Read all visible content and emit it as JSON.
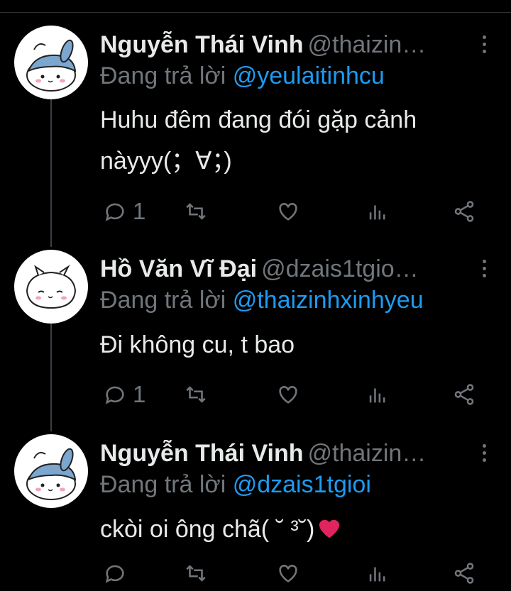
{
  "tweets": [
    {
      "name": "Nguyễn Thái Vinh",
      "handle": "@thaizin…",
      "reply_prefix": "Đang trả lời",
      "reply_to": "@yeulaitinhcu",
      "text_lines": [
        "Huhu đêm đang đói gặp cảnh",
        "nàyyy(；∀；)"
      ],
      "reply_count": "1",
      "avatar_icon": "cat-blue-hood-avatar"
    },
    {
      "name": "Hồ Văn Vĩ Đại",
      "handle": "@dzais1tgio…",
      "reply_prefix": "Đang trả lời",
      "reply_to": "@thaizinhxinhyeu",
      "text_lines": [
        "Đi không cu, t bao"
      ],
      "reply_count": "1",
      "avatar_icon": "cat-white-avatar"
    },
    {
      "name": "Nguyễn Thái Vinh",
      "handle": "@thaizin…",
      "reply_prefix": "Đang trả lời",
      "reply_to": "@dzais1tgioi",
      "text_lines": [
        "ckòi oi ông chã( ˘ ³˘)"
      ],
      "reply_count": "",
      "avatar_icon": "cat-blue-hood-avatar"
    }
  ],
  "colors": {
    "background": "#000000",
    "text": "#e7e9ea",
    "muted": "#71767b",
    "mention": "#1d9bf0",
    "heart": "#e0245e"
  }
}
